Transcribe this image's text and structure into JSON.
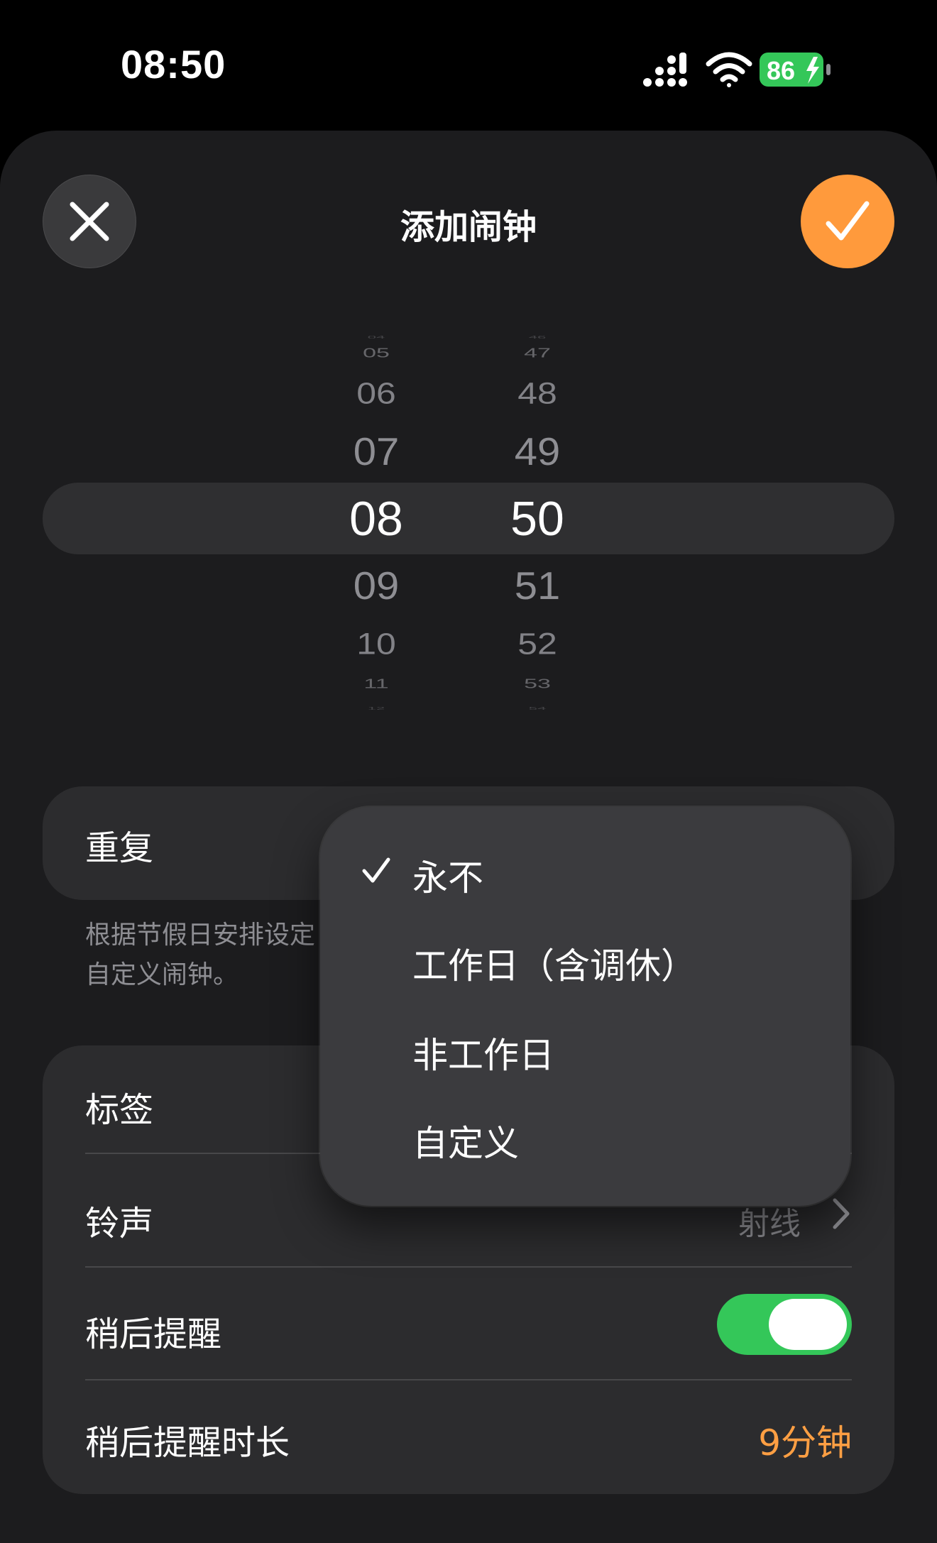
{
  "status_bar": {
    "time": "08:50",
    "battery": "86",
    "icons": [
      "cellular-signal-icon",
      "wifi-icon",
      "battery-charging-icon"
    ]
  },
  "header": {
    "title": "添加闹钟",
    "close_icon": "close-icon",
    "confirm_icon": "checkmark-icon"
  },
  "picker": {
    "hours": [
      "04",
      "05",
      "06",
      "07",
      "08",
      "09",
      "10",
      "11",
      "12"
    ],
    "minutes": [
      "46",
      "47",
      "48",
      "49",
      "50",
      "51",
      "52",
      "53",
      "54"
    ],
    "selected_hour": "08",
    "selected_minute": "50"
  },
  "repeat": {
    "label": "重复",
    "description": "根据节假日安排设定\n自定义闹钟。"
  },
  "repeat_menu": {
    "items": [
      {
        "label": "永不",
        "selected": true
      },
      {
        "label": "工作日（含调休）",
        "selected": false
      },
      {
        "label": "非工作日",
        "selected": false
      },
      {
        "label": "自定义",
        "selected": false
      }
    ]
  },
  "settings": {
    "tag_label": "标签",
    "ringtone_label": "铃声",
    "ringtone_value": "射线",
    "snooze_label": "稍后提醒",
    "snooze_on": true,
    "snooze_duration_label": "稍后提醒时长",
    "snooze_duration_value": "9分钟"
  },
  "colors": {
    "accent_orange": "#ff9a3c",
    "toggle_green": "#34c759",
    "battery_green": "#34c759"
  }
}
